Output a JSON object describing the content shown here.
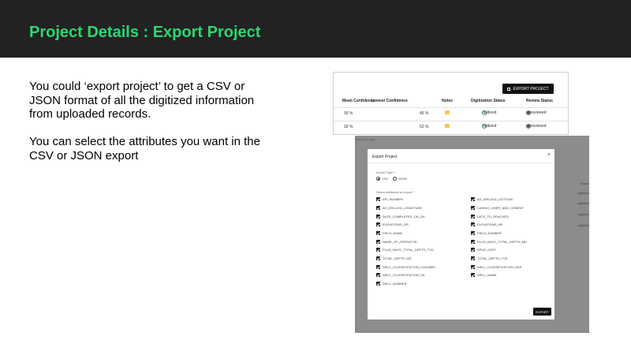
{
  "slide": {
    "title": "Project Details : Export Project",
    "paragraphs": [
      "You could ‘export project’ to get a CSV or JSON format of all the digitized information from uploaded records.",
      "You can select the attributes you want in the CSV or JSON export"
    ]
  },
  "table_screenshot": {
    "export_button": "EXPORT PROJECT",
    "columns": [
      "Mean Confidence",
      "Lowest Confidence",
      "Notes",
      "Digitization Status",
      "Review Status"
    ],
    "rows": [
      {
        "mean": "90 %",
        "lowest": "45 %",
        "status": "digitized",
        "review": "unreviewed"
      },
      {
        "mean": "93 %",
        "lowest": "62 %",
        "status": "digitized",
        "review": "unreviewed"
      }
    ]
  },
  "modal_screenshot": {
    "bg_left_text": "Records     Logs",
    "bg_right_items": [
      "Status",
      "digitized",
      "digitized",
      "digitized",
      "digitized"
    ],
    "title": "Export Project",
    "close_glyph": "×",
    "export_type_label": "Export Type *",
    "options": [
      "CSV",
      "JSON"
    ],
    "selected_option": "CSV",
    "attributes_label": "Select attributes to export *",
    "attributes_left": [
      "API_NUMBER",
      "AS_DRILLED_LONGITUDE",
      "DATE_COMPLETED_OR_DA",
      "ELEVATIONS_GR",
      "FIELD_NAME",
      "NAME_OF_OPERATOR",
      "PLUG_BACK_TOTAL_DEPTH_TVD",
      "TOTAL_DEPTH_MD",
      "WELL_CLASSIFICATION_COALBED",
      "WELL_CLASSIFICATION_OIL",
      "WELL_NUMBER"
    ],
    "attributes_right": [
      "AS_DRILLED_LATITUDE",
      "CASING_LINER_AND_CEMENT",
      "DATE_TD_REACHED",
      "ELEVATIONS_KB",
      "FIELD_NUMBER",
      "PLUG_BACK_TOTAL_DEPTH_MD",
      "SPUD_DATE",
      "TOTAL_DEPTH_TVD",
      "WELL_CLASSIFICATION_GAS",
      "WELL_NAME"
    ],
    "export_button": "EXPORT"
  },
  "colors": {
    "title_bar": "#222222",
    "title_text": "#2ed573",
    "overlay": "#8c8c8c"
  }
}
